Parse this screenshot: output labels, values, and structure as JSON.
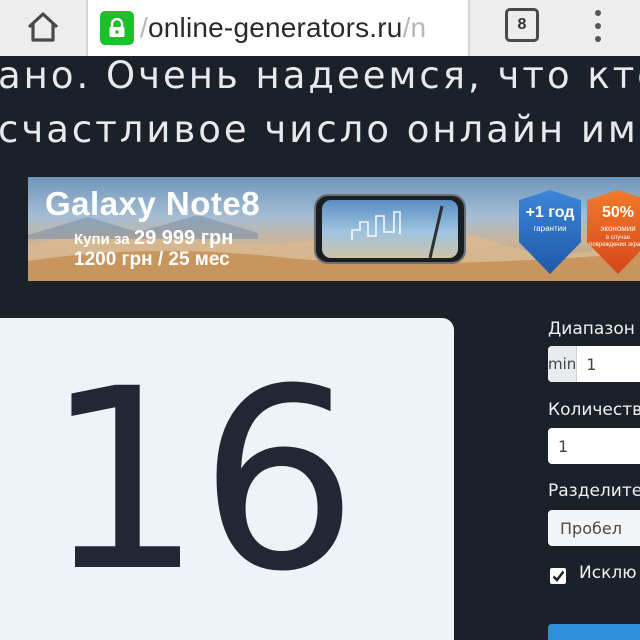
{
  "browser": {
    "url_prefix": "/",
    "url_host": "online-generators.ru",
    "url_suffix": "/n",
    "tab_count": "8"
  },
  "page": {
    "line1": "ано. Очень надеемся, что кто",
    "line2": "счастливое число онлайн име"
  },
  "ad": {
    "title": "Galaxy Note8",
    "price_prefix": "Купи за",
    "price_value": "29 999 грн",
    "credit": "1200 грн / 25 мес",
    "badge1_main": "+1 год",
    "badge1_sub": "гарантии",
    "badge2_main": "50%",
    "badge2_sub": "экономии",
    "badge2_fine": "в случае повреждения экрана"
  },
  "result": {
    "number": "16"
  },
  "settings": {
    "range_label": "Диапазон",
    "range_min_prefix": "min",
    "range_min_value": "1",
    "count_label": "Количеств",
    "count_value": "1",
    "separator_label": "Разделите",
    "separator_value": "Пробел",
    "exclude_label": "Исклю",
    "exclude_checked": true
  }
}
